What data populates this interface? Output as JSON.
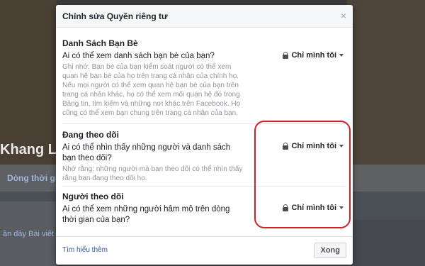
{
  "background": {
    "profile_name": "Khang Lê",
    "timeline_tab": "Dòng thời gia",
    "link_1": "ần đây",
    "link_2": "Bài viết"
  },
  "dialog": {
    "title": "Chỉnh sửa Quyền riêng tư",
    "close": "×",
    "sections": [
      {
        "title": "Danh Sách Bạn Bè",
        "question": "Ai có thể xem danh sách bạn bè của bạn?",
        "note": "Ghi nhớ: Bạn bè của bạn kiểm soát người có thể xem quan hệ bạn bè của họ trên trang cá nhân của chính họ. Nếu mọi người có thể xem quan hệ bạn bè của bạn trên trang cá nhân khác, họ có thể xem mối quan hệ đó trong Bảng tin, tìm kiếm và những nơi khác trên Facebook. Họ cũng có thể xem bạn chung trên trang cá nhân của bạn.",
        "audience": "Chỉ mình tôi"
      },
      {
        "title": "Đang theo dõi",
        "question": "Ai có thể nhìn thấy những người và danh sách bạn theo dõi?",
        "note": "Nhớ rằng: những người mà bạn theo dõi có thể nhìn thấy rằng bạn đang theo dõi họ.",
        "audience": "Chỉ mình tôi"
      },
      {
        "title": "Người theo dõi",
        "question": "Ai có thể xem những người hâm mộ trên dòng thời gian của bạn?",
        "audience": "Chỉ mình tôi"
      }
    ],
    "footer": {
      "learn_more": "Tìm hiểu thêm",
      "done": "Xong"
    }
  },
  "colors": {
    "highlight": "#d0202a",
    "link": "#365899"
  },
  "icons": [
    "lock-icon",
    "caret-down-icon",
    "close-icon"
  ]
}
